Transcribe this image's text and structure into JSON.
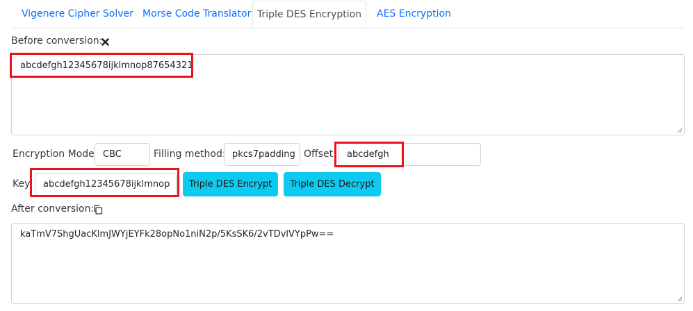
{
  "tabs": [
    {
      "label": "Vigenere Cipher Solver",
      "active": false
    },
    {
      "label": "Morse Code Translator",
      "active": false
    },
    {
      "label": "Triple DES Encryption",
      "active": true
    },
    {
      "label": "AES Encryption",
      "active": false
    }
  ],
  "input": {
    "label": "Before conversion:",
    "clear_icon": "close-x-icon",
    "value": "abcdefgh12345678ijklmnop87654321"
  },
  "options": {
    "mode_label": "Encryption Mode:",
    "mode_value": "CBC",
    "padding_label": "Filling method:",
    "padding_value": "pkcs7padding",
    "offset_label": "Offset:",
    "offset_value": "abcdefgh"
  },
  "key": {
    "label": "Key:",
    "value": "abcdefgh12345678ijklmnop"
  },
  "actions": {
    "encrypt_label": "Triple DES Encrypt",
    "decrypt_label": "Triple DES Decrypt"
  },
  "output": {
    "label": "After conversion:",
    "copy_icon": "copy-icon",
    "value": "kaTmV7ShgUacKlmJWYjEYFk28opNo1niN2p/5KsSK6/2vTDvlVYpPw=="
  },
  "colors": {
    "accent": "#0dcaf0",
    "tab_link": "#0d6efd",
    "highlight": "#e8141b"
  }
}
